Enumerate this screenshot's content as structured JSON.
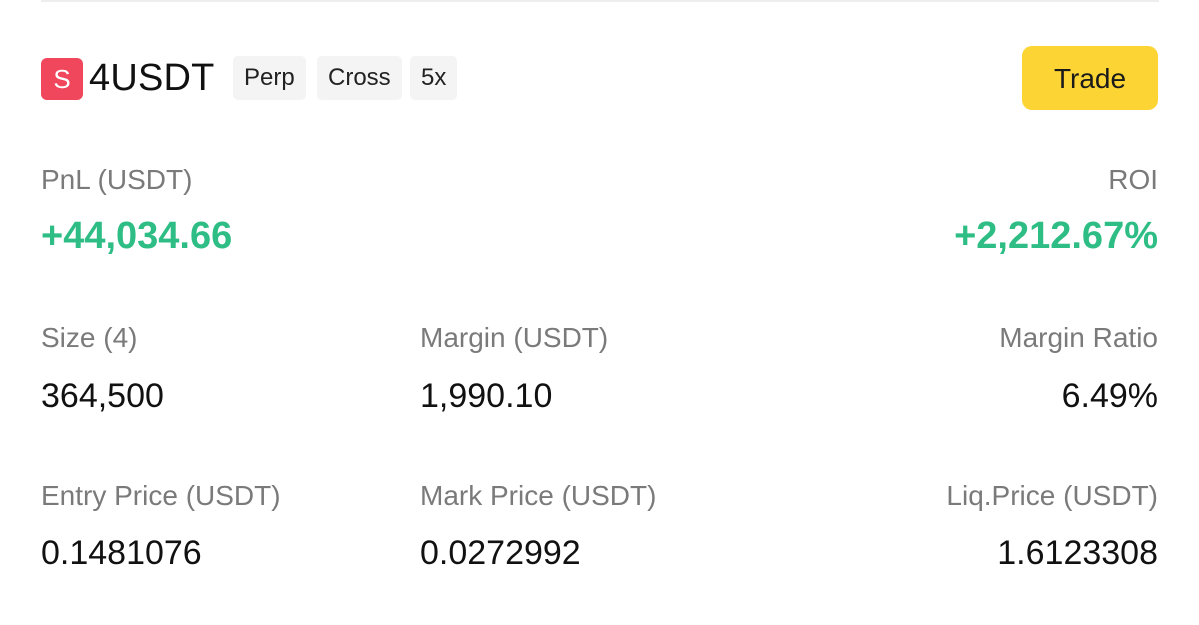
{
  "header": {
    "side_badge": "S",
    "symbol": "4USDT",
    "tags": [
      "Perp",
      "Cross",
      "5x"
    ],
    "trade_label": "Trade"
  },
  "pnl": {
    "label": "PnL (USDT)",
    "value": "+44,034.66"
  },
  "roi": {
    "label": "ROI",
    "value": "+2,212.67%"
  },
  "size": {
    "label": "Size (4)",
    "value": "364,500"
  },
  "margin": {
    "label": "Margin (USDT)",
    "value": "1,990.10"
  },
  "margin_ratio": {
    "label": "Margin Ratio",
    "value": "6.49%"
  },
  "entry_price": {
    "label": "Entry Price (USDT)",
    "value": "0.1481076"
  },
  "mark_price": {
    "label": "Mark Price (USDT)",
    "value": "0.0272992"
  },
  "liq_price": {
    "label": "Liq.Price (USDT)",
    "value": "1.6123308"
  },
  "colors": {
    "profit_green": "#2ebd85",
    "short_badge_red": "#f0475d",
    "trade_button_yellow": "#fcd535"
  }
}
